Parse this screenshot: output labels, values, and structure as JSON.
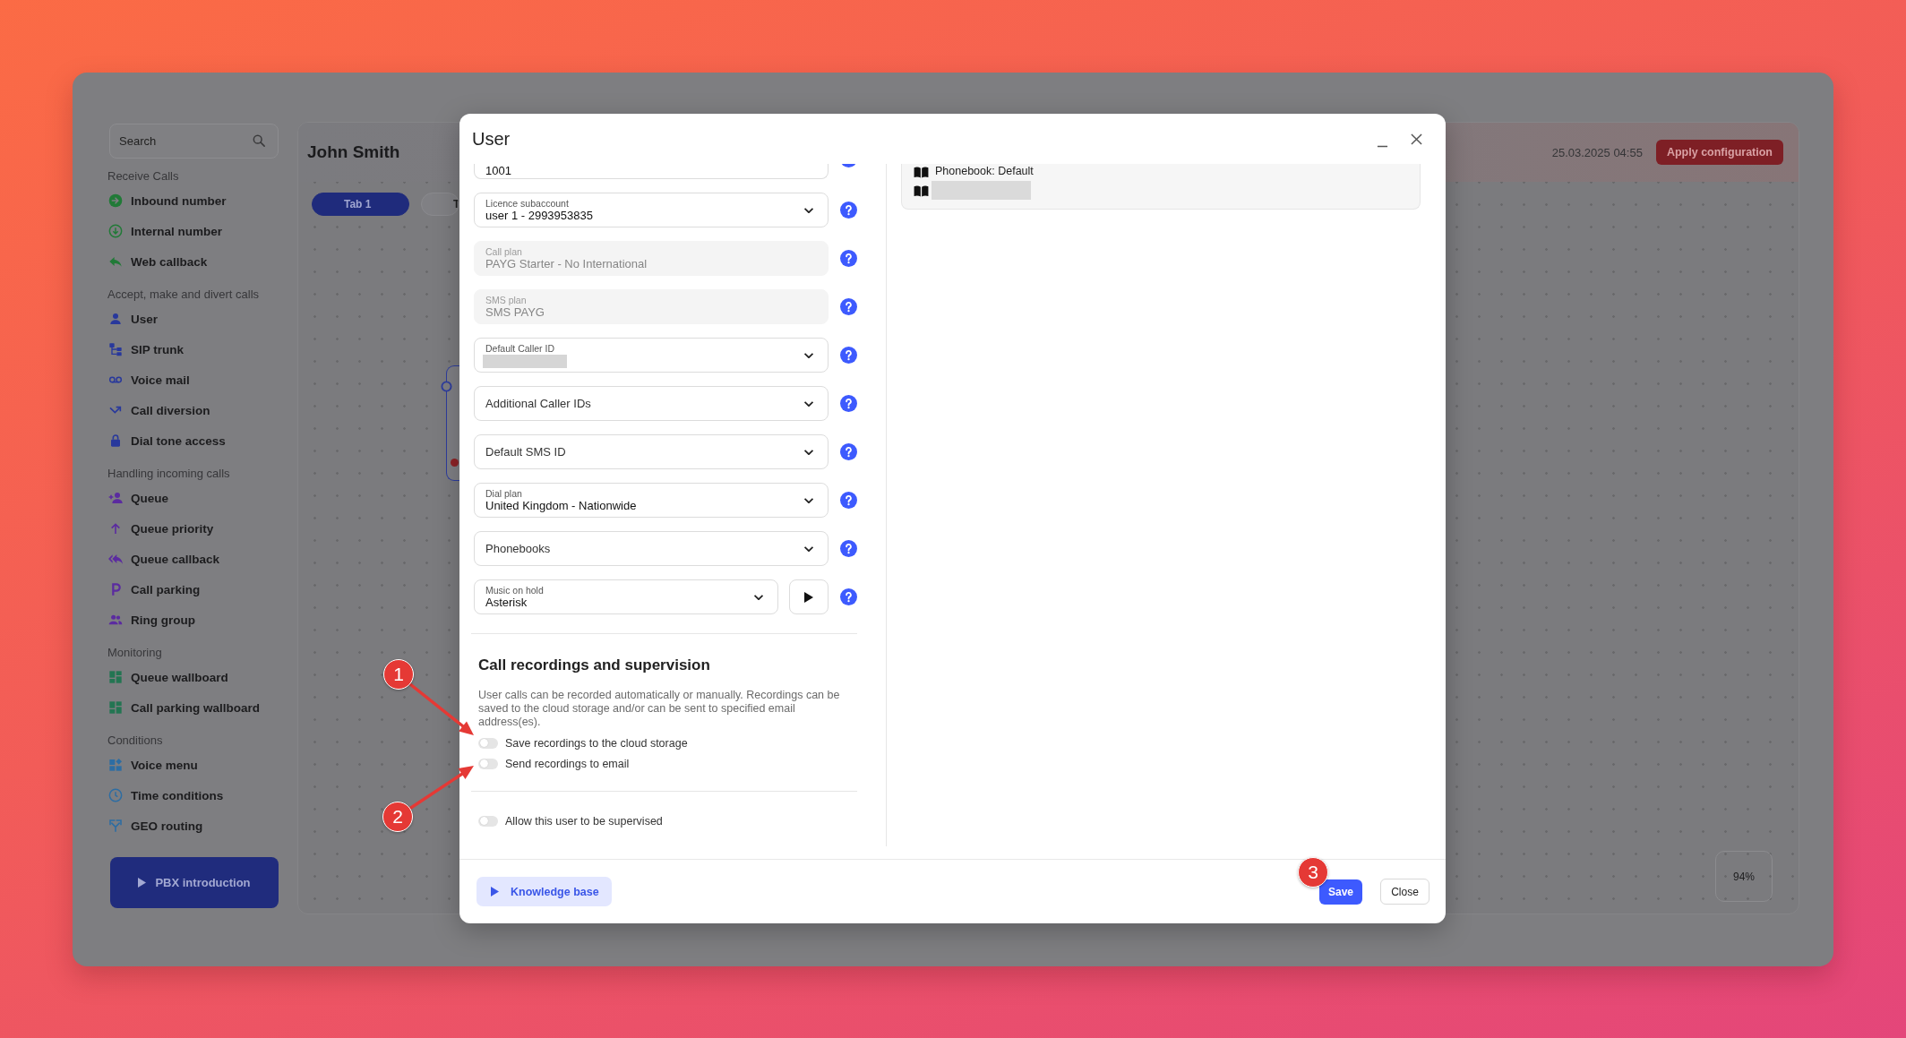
{
  "app": {
    "sidebar": {
      "search": {
        "placeholder": "Search"
      },
      "sections": [
        {
          "title": "Receive Calls",
          "items": [
            "Inbound number",
            "Internal number",
            "Web callback"
          ]
        },
        {
          "title": "Accept, make and divert calls",
          "items": [
            "User",
            "SIP trunk",
            "Voice mail",
            "Call diversion",
            "Dial tone access"
          ]
        },
        {
          "title": "Handling incoming calls",
          "items": [
            "Queue",
            "Queue priority",
            "Queue callback",
            "Call parking",
            "Ring group"
          ]
        },
        {
          "title": "Monitoring",
          "items": [
            "Queue wallboard",
            "Call parking wallboard"
          ]
        },
        {
          "title": "Conditions",
          "items": [
            "Voice menu",
            "Time conditions",
            "GEO routing"
          ]
        }
      ],
      "intro_button": "PBX introduction"
    },
    "workspace": {
      "title": "John Smith",
      "tabs": [
        {
          "label": "Tab 1",
          "selected": true
        },
        {
          "label": "T",
          "selected": false
        }
      ],
      "timestamp": "25.03.2025 04:55",
      "apply_button": "Apply configuration",
      "zoom": "94%"
    }
  },
  "dialog": {
    "title": "User",
    "fields": [
      {
        "kind": "partial",
        "value": "1001",
        "disabled": false,
        "redacted": false
      },
      {
        "kind": "select",
        "label": "Licence subaccount",
        "value": "user 1 - 2993953835",
        "disabled": false,
        "redacted": false
      },
      {
        "kind": "text",
        "label": "Call plan",
        "value": "PAYG Starter - No International",
        "disabled": true,
        "redacted": false
      },
      {
        "kind": "text",
        "label": "SMS plan",
        "value": "SMS PAYG",
        "disabled": true,
        "redacted": false
      },
      {
        "kind": "select",
        "label": "Default Caller ID",
        "disabled": false,
        "redacted": true
      },
      {
        "kind": "select",
        "label": "Additional Caller IDs",
        "disabled": false,
        "redacted": false
      },
      {
        "kind": "select",
        "label": "Default SMS ID",
        "disabled": false,
        "redacted": false
      },
      {
        "kind": "select",
        "label": "Dial plan",
        "value": "United Kingdom - Nationwide",
        "disabled": false,
        "redacted": false
      },
      {
        "kind": "select",
        "label": "Phonebooks",
        "disabled": false,
        "redacted": false
      },
      {
        "kind": "audio",
        "label": "Music on hold",
        "value": "Asterisk",
        "disabled": false,
        "redacted": false
      }
    ],
    "recording": {
      "title": "Call recordings and supervision",
      "description": "User calls can be recorded automatically or manually. Recordings can be saved to the cloud storage and/or can be sent to specified email address(es).",
      "toggles": [
        {
          "label": "Save recordings to the cloud storage",
          "on": false
        },
        {
          "label": "Send recordings to email",
          "on": false
        }
      ]
    },
    "supervision_toggle": {
      "label": "Allow this user to be supervised",
      "on": false
    },
    "phonebooks": [
      {
        "label": "Phonebook: Default",
        "redacted": false
      },
      {
        "redacted": true
      }
    ],
    "footer": {
      "knowledge_button": "Knowledge base",
      "save_button": "Save",
      "close_button": "Close"
    }
  },
  "annotations": [
    {
      "label": "1"
    },
    {
      "label": "2"
    },
    {
      "label": "3"
    }
  ]
}
